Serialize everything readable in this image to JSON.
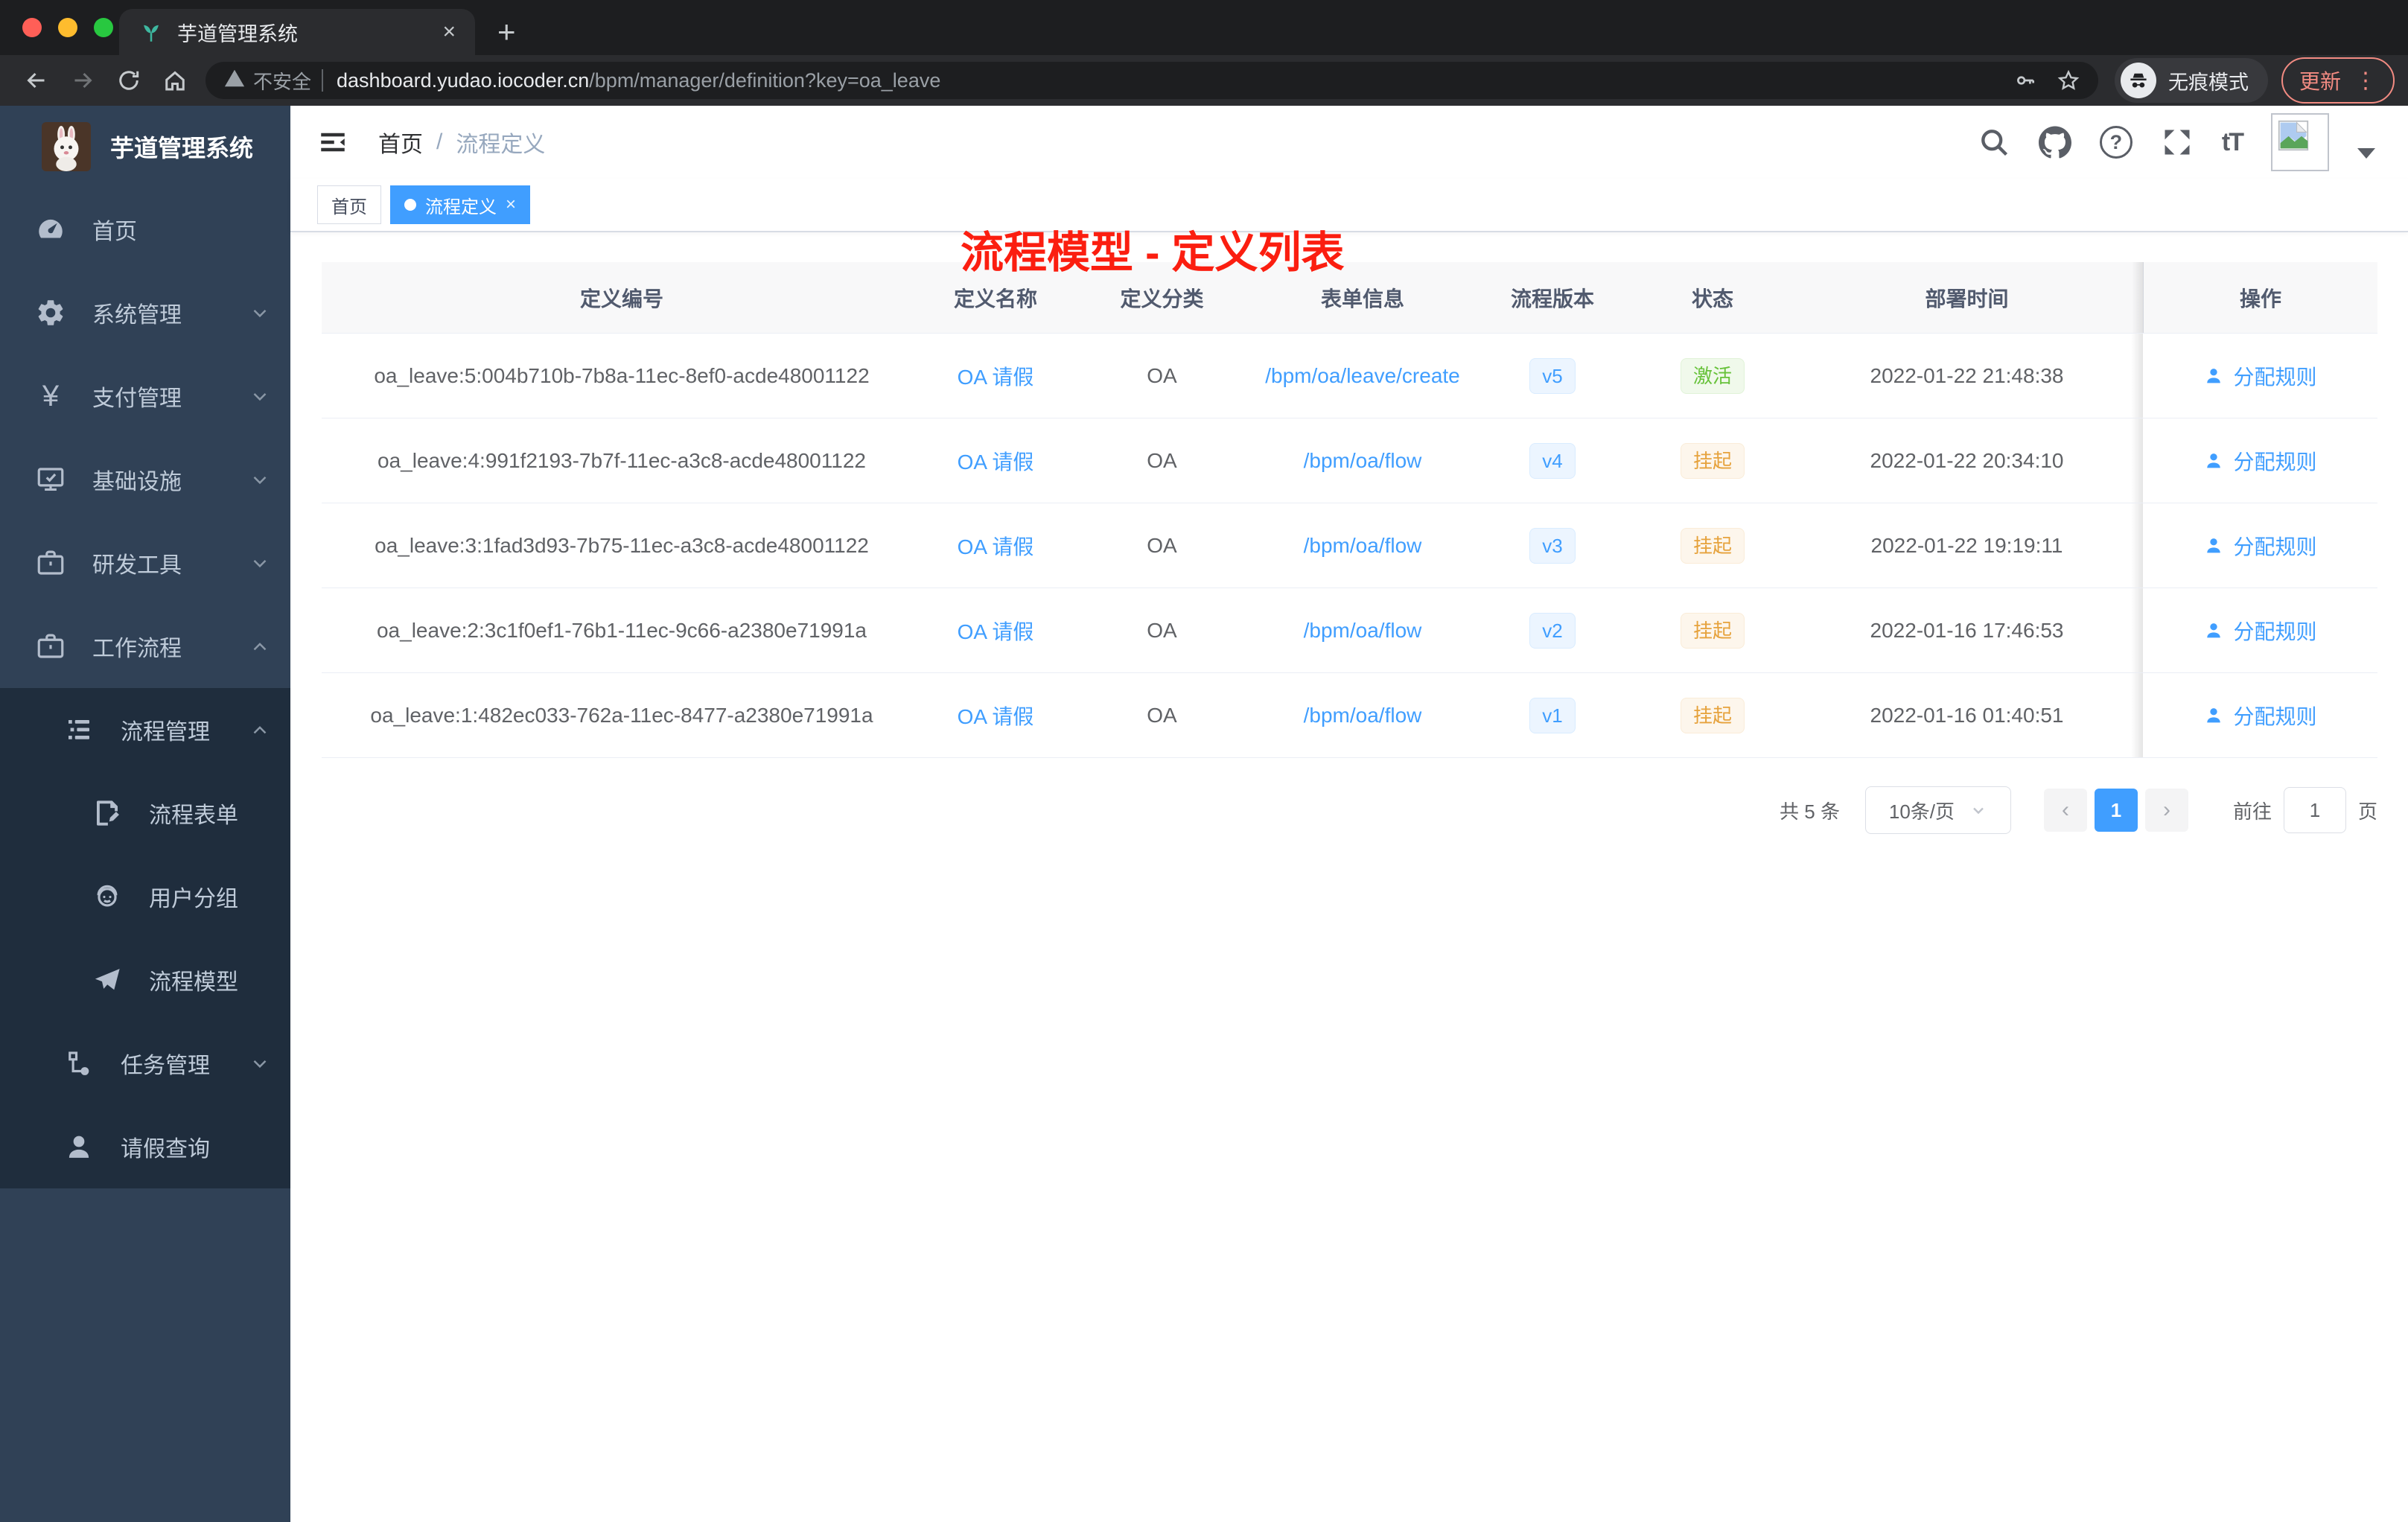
{
  "colors": {
    "accent_blue": "#409eff",
    "annotation_red": "#fb1e10",
    "status_active_green": "#67c23a",
    "status_suspend_orange": "#e6a23c",
    "sidebar_bg": "#304156",
    "sidebar_submenu_bg": "#1f2d3d"
  },
  "glyphs": {
    "tab_close": "×",
    "new_tab": "+",
    "breadcrumb_separator": "/",
    "tag_close": "×",
    "prev": "‹",
    "next": "›",
    "help": "?",
    "font_size": "tT",
    "yen": "¥",
    "vertical_dots": "⋮"
  },
  "browser": {
    "tab_title": "芋道管理系统",
    "security_label": "不安全",
    "url_host": "dashboard.yudao.iocoder.cn",
    "url_path": "/bpm/manager/definition?key=oa_leave",
    "incognito_label": "无痕模式",
    "update_label": "更新"
  },
  "sidebar": {
    "app_title": "芋道管理系统",
    "items": [
      {
        "key": "home",
        "label": "首页",
        "icon": "dashboard-icon",
        "level": 0,
        "chevron": "",
        "submenu": false
      },
      {
        "key": "system",
        "label": "系统管理",
        "icon": "gear-icon",
        "level": 0,
        "chevron": "down",
        "submenu": false
      },
      {
        "key": "payment",
        "label": "支付管理",
        "icon": "yen-icon",
        "level": 0,
        "chevron": "down",
        "submenu": false
      },
      {
        "key": "infrastructure",
        "label": "基础设施",
        "icon": "monitor-icon",
        "level": 0,
        "chevron": "down",
        "submenu": false
      },
      {
        "key": "devtools",
        "label": "研发工具",
        "icon": "briefcase-icon",
        "level": 0,
        "chevron": "down",
        "submenu": false
      },
      {
        "key": "workflow",
        "label": "工作流程",
        "icon": "briefcase-icon",
        "level": 0,
        "chevron": "up",
        "submenu": false
      },
      {
        "key": "process-management",
        "label": "流程管理",
        "icon": "list-icon",
        "level": 1,
        "chevron": "up",
        "submenu": true
      },
      {
        "key": "process-form",
        "label": "流程表单",
        "icon": "form-icon",
        "level": 2,
        "chevron": "",
        "submenu": true
      },
      {
        "key": "user-group",
        "label": "用户分组",
        "icon": "user-group-icon",
        "level": 2,
        "chevron": "",
        "submenu": true
      },
      {
        "key": "process-model",
        "label": "流程模型",
        "icon": "paper-plane-icon",
        "level": 2,
        "chevron": "",
        "submenu": true
      },
      {
        "key": "task-management",
        "label": "任务管理",
        "icon": "tasks-icon",
        "level": 1,
        "chevron": "down",
        "submenu": true
      },
      {
        "key": "leave-query",
        "label": "请假查询",
        "icon": "user-icon",
        "level": 1,
        "chevron": "",
        "submenu": true
      }
    ]
  },
  "header": {
    "breadcrumb": [
      "首页",
      "流程定义"
    ],
    "annotation": "流程模型 - 定义列表"
  },
  "tags": [
    {
      "label": "首页",
      "active": false
    },
    {
      "label": "流程定义",
      "active": true
    }
  ],
  "table": {
    "columns": [
      "定义编号",
      "定义名称",
      "定义分类",
      "表单信息",
      "流程版本",
      "状态",
      "部署时间",
      "操作"
    ],
    "rows": [
      {
        "id": "oa_leave:5:004b710b-7b8a-11ec-8ef0-acde48001122",
        "name": "OA 请假",
        "category": "OA",
        "form": "/bpm/oa/leave/create",
        "version": "v5",
        "status": "激活",
        "status_type": "success",
        "deploy_time": "2022-01-22 21:48:38",
        "action": "分配规则"
      },
      {
        "id": "oa_leave:4:991f2193-7b7f-11ec-a3c8-acde48001122",
        "name": "OA 请假",
        "category": "OA",
        "form": "/bpm/oa/flow",
        "version": "v4",
        "status": "挂起",
        "status_type": "warning",
        "deploy_time": "2022-01-22 20:34:10",
        "action": "分配规则"
      },
      {
        "id": "oa_leave:3:1fad3d93-7b75-11ec-a3c8-acde48001122",
        "name": "OA 请假",
        "category": "OA",
        "form": "/bpm/oa/flow",
        "version": "v3",
        "status": "挂起",
        "status_type": "warning",
        "deploy_time": "2022-01-22 19:19:11",
        "action": "分配规则"
      },
      {
        "id": "oa_leave:2:3c1f0ef1-76b1-11ec-9c66-a2380e71991a",
        "name": "OA 请假",
        "category": "OA",
        "form": "/bpm/oa/flow",
        "version": "v2",
        "status": "挂起",
        "status_type": "warning",
        "deploy_time": "2022-01-16 17:46:53",
        "action": "分配规则"
      },
      {
        "id": "oa_leave:1:482ec033-762a-11ec-8477-a2380e71991a",
        "name": "OA 请假",
        "category": "OA",
        "form": "/bpm/oa/flow",
        "version": "v1",
        "status": "挂起",
        "status_type": "warning",
        "deploy_time": "2022-01-16 01:40:51",
        "action": "分配规则"
      }
    ]
  },
  "pagination": {
    "total": "共 5 条",
    "page_size": "10条/页",
    "current_page": "1",
    "goto_label": "前往",
    "goto_value": "1",
    "unit_label": "页"
  }
}
